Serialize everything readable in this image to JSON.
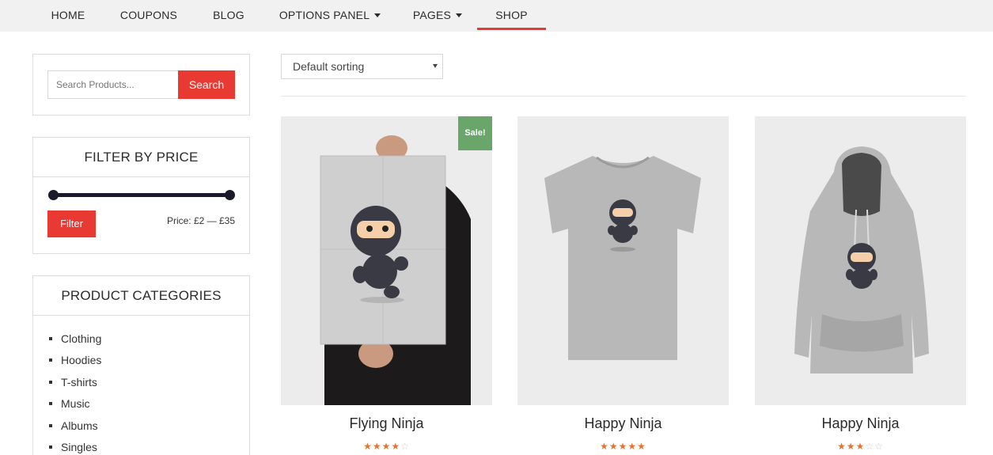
{
  "nav": {
    "items": [
      {
        "label": "HOME",
        "has_caret": false
      },
      {
        "label": "COUPONS",
        "has_caret": false
      },
      {
        "label": "BLOG",
        "has_caret": false
      },
      {
        "label": "OPTIONS PANEL",
        "has_caret": true
      },
      {
        "label": "PAGES",
        "has_caret": true
      },
      {
        "label": "SHOP",
        "has_caret": false,
        "active": true
      }
    ],
    "accent_color": "#e83a33"
  },
  "search": {
    "placeholder": "Search Products...",
    "button_label": "Search"
  },
  "price_filter": {
    "title": "FILTER BY PRICE",
    "button_label": "Filter",
    "range_text": "Price: £2 — £35",
    "min": 2,
    "max": 35
  },
  "categories": {
    "title": "PRODUCT CATEGORIES",
    "items": [
      "Clothing",
      "Hoodies",
      "T-shirts",
      "Music",
      "Albums",
      "Singles"
    ]
  },
  "sorting": {
    "selected": "Default sorting"
  },
  "products": [
    {
      "name": "Flying Ninja",
      "rating": 4,
      "on_sale": true,
      "sale_label": "Sale!",
      "image": "poster-ninja"
    },
    {
      "name": "Happy Ninja",
      "rating": 5,
      "on_sale": false,
      "image": "tshirt-ninja"
    },
    {
      "name": "Happy Ninja",
      "rating": 3,
      "on_sale": false,
      "image": "hoodie-ninja"
    }
  ],
  "colors": {
    "accent": "#e83a33",
    "sale_badge": "#6aa56a",
    "star": "#e8742b"
  }
}
